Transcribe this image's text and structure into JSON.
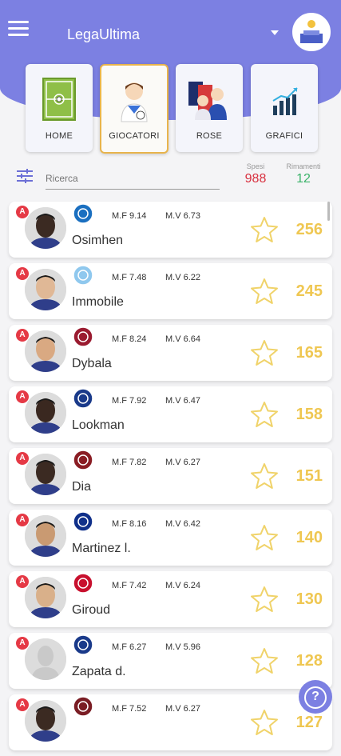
{
  "header": {
    "title": "LegaUltima"
  },
  "nav": [
    {
      "label": "HOME",
      "icon": "soccer-field-icon"
    },
    {
      "label": "GIOCATORI",
      "icon": "player-icon",
      "active": true
    },
    {
      "label": "ROSE",
      "icon": "squad-icon"
    },
    {
      "label": "GRAFICI",
      "icon": "chart-icon"
    }
  ],
  "search": {
    "placeholder": "Ricerca"
  },
  "stats": {
    "spent_label": "Spesi",
    "spent_value": "988",
    "remaining_label": "Rimamenti",
    "remaining_value": "12"
  },
  "players": [
    {
      "role": "A",
      "name": "Osimhen",
      "mf": "M.F 9.14",
      "mv": "M.V 6.73",
      "price": "256",
      "team": "napoli-logo",
      "team_color": "#1a6fc0"
    },
    {
      "role": "A",
      "name": "Immobile",
      "mf": "M.F 7.48",
      "mv": "M.V 6.22",
      "price": "245",
      "team": "lazio-logo",
      "team_color": "#8fc8ee"
    },
    {
      "role": "A",
      "name": "Dybala",
      "mf": "M.F 8.24",
      "mv": "M.V 6.64",
      "price": "165",
      "team": "roma-logo",
      "team_color": "#9a1b30"
    },
    {
      "role": "A",
      "name": "Lookman",
      "mf": "M.F 7.92",
      "mv": "M.V 6.47",
      "price": "158",
      "team": "atalanta-logo",
      "team_color": "#1a3a8a"
    },
    {
      "role": "A",
      "name": "Dia",
      "mf": "M.F 7.82",
      "mv": "M.V 6.27",
      "price": "151",
      "team": "salernitana-logo",
      "team_color": "#8a1d24"
    },
    {
      "role": "A",
      "name": "Martinez l.",
      "mf": "M.F 8.16",
      "mv": "M.V 6.42",
      "price": "140",
      "team": "inter-logo",
      "team_color": "#10308a"
    },
    {
      "role": "A",
      "name": "Giroud",
      "mf": "M.F 7.42",
      "mv": "M.V 6.24",
      "price": "130",
      "team": "milan-logo",
      "team_color": "#c8102e"
    },
    {
      "role": "A",
      "name": "Zapata d.",
      "mf": "M.F 6.27",
      "mv": "M.V 5.96",
      "price": "128",
      "team": "atalanta-logo",
      "team_color": "#1a3a8a"
    },
    {
      "role": "A",
      "name": "",
      "mf": "M.F 7.52",
      "mv": "M.V 6.27",
      "price": "127",
      "team": "torino-logo",
      "team_color": "#7a1d24"
    }
  ],
  "help": {
    "icon": "help-icon"
  },
  "colors": {
    "accent": "#7c80e2",
    "price": "#efc752",
    "spent": "#d8303f",
    "remaining": "#3bb36a",
    "role": "#e53945"
  }
}
